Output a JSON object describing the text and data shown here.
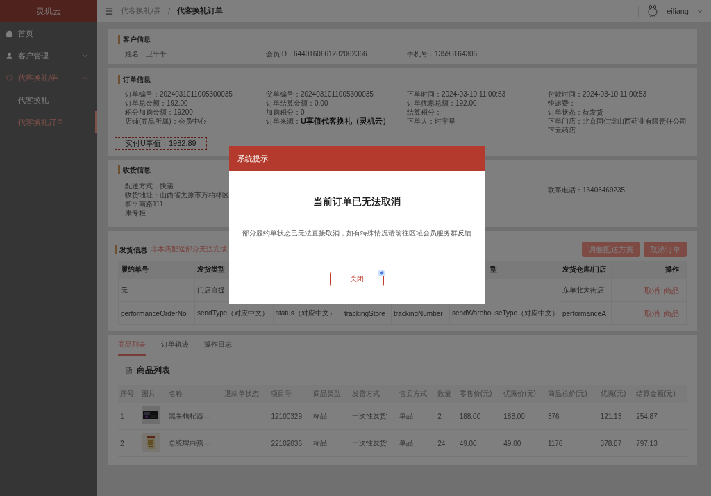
{
  "sidebar": {
    "logo": "灵玑云",
    "items": [
      {
        "label": "首页",
        "kind": "link",
        "selected": false
      },
      {
        "label": "客户管理",
        "kind": "group",
        "selected": false,
        "expanded": false
      },
      {
        "label": "代客换礼/券",
        "kind": "group",
        "selected": true,
        "expanded": true,
        "children": [
          {
            "label": "代客换礼",
            "selected": false
          },
          {
            "label": "代客换礼订单",
            "selected": true
          }
        ]
      }
    ]
  },
  "header": {
    "breadcrumb": [
      "代客换礼/券",
      "代客换礼订单"
    ],
    "separator": "/",
    "user": "eiliang"
  },
  "customer_info": {
    "title": "客户信息",
    "fields": [
      "姓名：卫平平",
      "会员ID：6440160661282062366",
      "手机号：13593164306"
    ]
  },
  "order_info": {
    "title": "订单信息",
    "columns": [
      [
        "订单编号：2024031011005300035",
        "订单总金额：192.00",
        "积分加购金额：19200",
        "店铺(商品所属)：会员中心"
      ],
      [
        "父单编号：2024031011005300035",
        "订单结算金额：0.00",
        "加购积分：0",
        "订单来源：**U享值代客换礼（灵机云）**"
      ],
      [
        "下单时间：2024-03-10 11:00:53",
        "订单优惠总额：192.00",
        "结算积分：",
        "下单人：时宇星"
      ],
      [
        "付款时间：2024-03-10 11:00:53",
        "快递费：",
        "订单状态：待发货",
        "下单门店：北京同仁堂山西药业有限责任公司下元药店"
      ]
    ],
    "paid": "实付U享值：1982.89"
  },
  "receive_info": {
    "title": "收货信息",
    "delivery": "配送方式：快递",
    "address": "收货地址：山西省太原市万柏林区和平南路111",
    "address_cont": "康专柜",
    "phone": "联系电话：13403469235"
  },
  "shipping": {
    "title": "发货信息",
    "note": "非本店配送部分无法完成",
    "buttons": [
      "调整配送方案",
      "取消订单"
    ],
    "columns": [
      "履约单号",
      "发货类型",
      null,
      null,
      null,
      "型",
      "发货仓库/门店"
    ],
    "action_column": "操作",
    "rows": [
      {
        "cells": [
          "无",
          "门店自提",
          null,
          null,
          null,
          null,
          "东单北大街店"
        ],
        "actions": [
          "取消",
          "商品"
        ]
      },
      {
        "cells": [
          "performanceOrderNo",
          "sendType（对应中文）",
          "status（对应中文）",
          "trackingStore",
          "trackingNumber",
          "sendWarehouseType（对应中文）",
          "performanceA"
        ],
        "actions": [
          "取消",
          "商品"
        ]
      }
    ]
  },
  "tabs": [
    {
      "label": "商品列表",
      "selected": true
    },
    {
      "label": "订单轨迹",
      "selected": false
    },
    {
      "label": "操作日志",
      "selected": false
    }
  ],
  "product_list": {
    "title": "商品列表",
    "columns": [
      "序号",
      "图片",
      "名称",
      "退款单状态",
      "项目号",
      "商品类型",
      "发货方式",
      "售卖方式",
      "数量",
      "零售价(元)",
      "优惠价(元)",
      "商品总价(元)",
      "优惠(元)",
      "结算金额(元)"
    ],
    "rows": [
      {
        "cells": [
          "1",
          {
            "kind": "picture"
          },
          "黑果枸杞器…",
          "",
          "12100329",
          "标品",
          "一次性发货",
          "单品",
          "2",
          "188.00",
          "188.00",
          "376",
          "121.13",
          "254.87"
        ]
      },
      {
        "cells": [
          "2",
          {
            "kind": "picture"
          },
          "总统牌白燕…",
          "",
          "22102036",
          "标品",
          "一次性发货",
          "单品",
          "24",
          "49.00",
          "49.00",
          "1176",
          "378.87",
          "797.13"
        ]
      }
    ]
  },
  "modal": {
    "title": "系统提示",
    "heading": "当前订单已无法取消",
    "message": "部分履约单状态已无法直接取消，如有特殊情况请前往区域会员服务群反馈",
    "button": "关闭"
  }
}
